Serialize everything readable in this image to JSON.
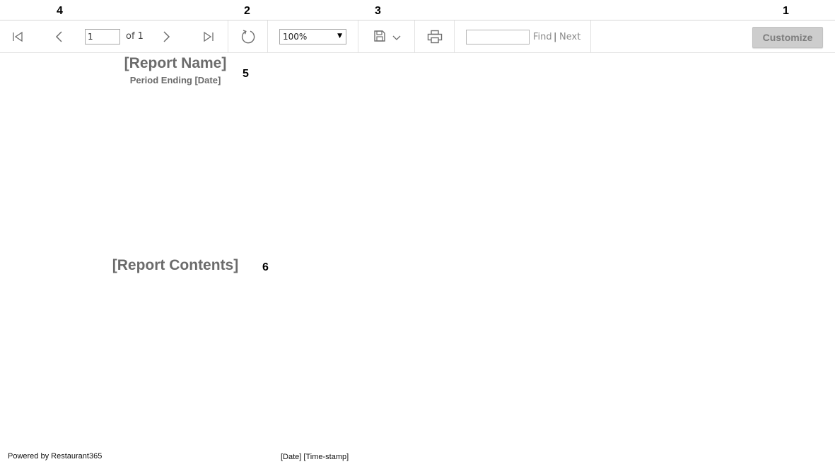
{
  "callouts": {
    "c1": "1",
    "c2": "2",
    "c3": "3",
    "c4": "4",
    "c5": "5",
    "c6": "6"
  },
  "toolbar": {
    "page_value": "1",
    "page_of": "of 1",
    "zoom_value": "100%",
    "find_label": "Find",
    "find_separator": "|",
    "next_label": "Next",
    "customize_label": "Customize",
    "icons": {
      "first": "first-page-icon",
      "prev": "previous-page-icon",
      "next": "next-page-icon",
      "last": "last-page-icon",
      "refresh": "refresh-icon",
      "save": "save-icon",
      "save_menu": "chevron-down-icon",
      "print": "print-icon"
    }
  },
  "report": {
    "name": "[Report Name]",
    "period": "Period Ending [Date]",
    "contents": "[Report Contents]"
  },
  "footer": {
    "powered_by": "Powered by Restaurant365",
    "timestamp": "[Date] [Time-stamp]"
  },
  "colors": {
    "icon": "#6e6e6e",
    "muted_text": "#8a8a8a",
    "report_text": "#6b6b6b",
    "button_bg": "#cdcdcd",
    "button_text": "#7d7d7d"
  }
}
